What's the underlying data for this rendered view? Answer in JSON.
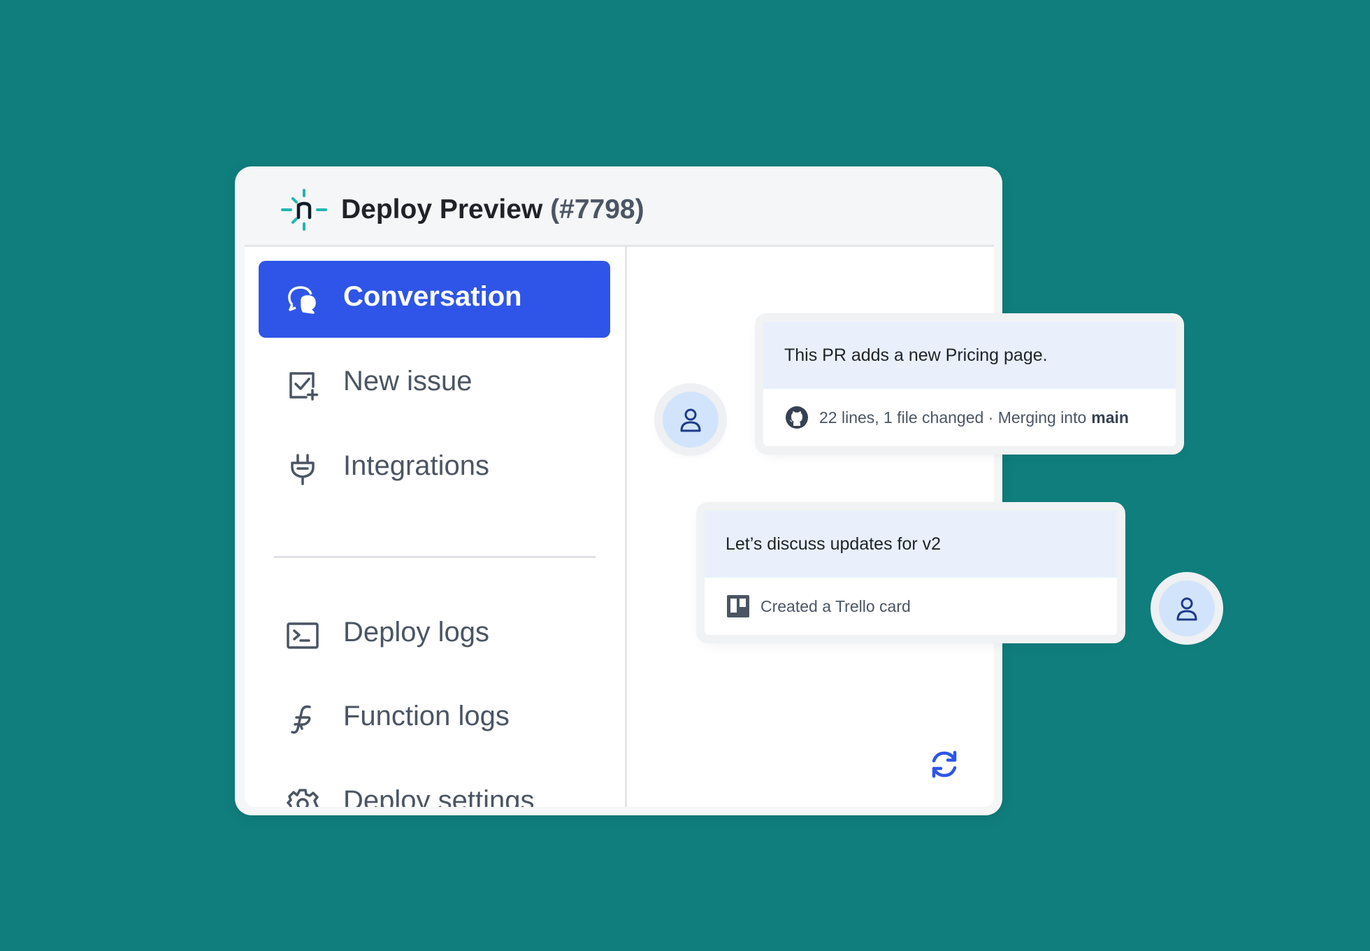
{
  "header": {
    "logo_icon": "netlify-logo-icon",
    "title": "Deploy Preview",
    "number": "(#7798)"
  },
  "sidebar": {
    "items": [
      {
        "label": "Conversation",
        "icon": "chat-bubbles-icon",
        "active": true
      },
      {
        "label": "New issue",
        "icon": "checkbox-plus-icon",
        "active": false
      },
      {
        "label": "Integrations",
        "icon": "plug-icon",
        "active": false
      },
      {
        "label": "Deploy logs",
        "icon": "terminal-icon",
        "active": false
      },
      {
        "label": "Function logs",
        "icon": "function-icon",
        "active": false
      },
      {
        "label": "Deploy settings",
        "icon": "gear-icon",
        "active": false
      }
    ]
  },
  "cards": [
    {
      "message": "This PR adds a new Pricing page.",
      "meta_icon": "github-icon",
      "meta_text": "22 lines, 1 file changed · Merging into",
      "meta_bold": "main"
    },
    {
      "message": "Let’s discuss updates for v2",
      "meta_icon": "trello-icon",
      "meta_text": "Created a Trello card"
    }
  ],
  "colors": {
    "background": "#107e7d",
    "accent": "#2f55e8",
    "card_message_bg": "#e9f0fc",
    "avatar_bg": "#d2e4fb"
  }
}
